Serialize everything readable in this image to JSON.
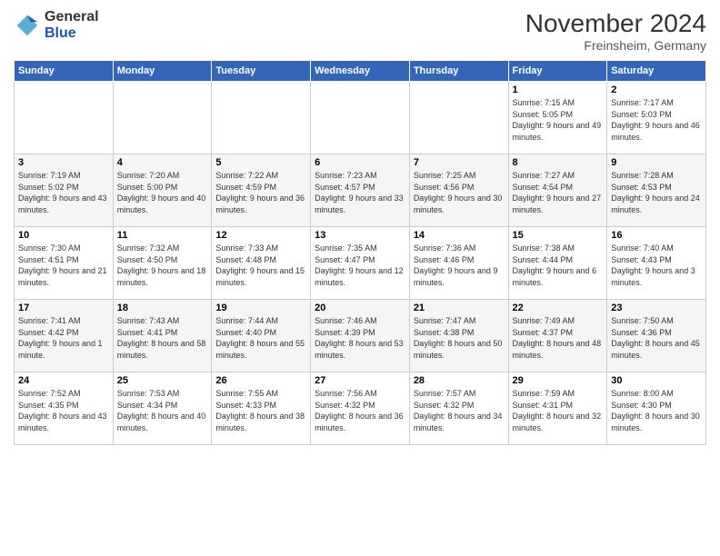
{
  "logo": {
    "general": "General",
    "blue": "Blue"
  },
  "title": "November 2024",
  "subtitle": "Freinsheim, Germany",
  "weekdays": [
    "Sunday",
    "Monday",
    "Tuesday",
    "Wednesday",
    "Thursday",
    "Friday",
    "Saturday"
  ],
  "weeks": [
    [
      {
        "day": "",
        "info": ""
      },
      {
        "day": "",
        "info": ""
      },
      {
        "day": "",
        "info": ""
      },
      {
        "day": "",
        "info": ""
      },
      {
        "day": "",
        "info": ""
      },
      {
        "day": "1",
        "info": "Sunrise: 7:15 AM\nSunset: 5:05 PM\nDaylight: 9 hours and 49 minutes."
      },
      {
        "day": "2",
        "info": "Sunrise: 7:17 AM\nSunset: 5:03 PM\nDaylight: 9 hours and 46 minutes."
      }
    ],
    [
      {
        "day": "3",
        "info": "Sunrise: 7:19 AM\nSunset: 5:02 PM\nDaylight: 9 hours and 43 minutes."
      },
      {
        "day": "4",
        "info": "Sunrise: 7:20 AM\nSunset: 5:00 PM\nDaylight: 9 hours and 40 minutes."
      },
      {
        "day": "5",
        "info": "Sunrise: 7:22 AM\nSunset: 4:59 PM\nDaylight: 9 hours and 36 minutes."
      },
      {
        "day": "6",
        "info": "Sunrise: 7:23 AM\nSunset: 4:57 PM\nDaylight: 9 hours and 33 minutes."
      },
      {
        "day": "7",
        "info": "Sunrise: 7:25 AM\nSunset: 4:56 PM\nDaylight: 9 hours and 30 minutes."
      },
      {
        "day": "8",
        "info": "Sunrise: 7:27 AM\nSunset: 4:54 PM\nDaylight: 9 hours and 27 minutes."
      },
      {
        "day": "9",
        "info": "Sunrise: 7:28 AM\nSunset: 4:53 PM\nDaylight: 9 hours and 24 minutes."
      }
    ],
    [
      {
        "day": "10",
        "info": "Sunrise: 7:30 AM\nSunset: 4:51 PM\nDaylight: 9 hours and 21 minutes."
      },
      {
        "day": "11",
        "info": "Sunrise: 7:32 AM\nSunset: 4:50 PM\nDaylight: 9 hours and 18 minutes."
      },
      {
        "day": "12",
        "info": "Sunrise: 7:33 AM\nSunset: 4:48 PM\nDaylight: 9 hours and 15 minutes."
      },
      {
        "day": "13",
        "info": "Sunrise: 7:35 AM\nSunset: 4:47 PM\nDaylight: 9 hours and 12 minutes."
      },
      {
        "day": "14",
        "info": "Sunrise: 7:36 AM\nSunset: 4:46 PM\nDaylight: 9 hours and 9 minutes."
      },
      {
        "day": "15",
        "info": "Sunrise: 7:38 AM\nSunset: 4:44 PM\nDaylight: 9 hours and 6 minutes."
      },
      {
        "day": "16",
        "info": "Sunrise: 7:40 AM\nSunset: 4:43 PM\nDaylight: 9 hours and 3 minutes."
      }
    ],
    [
      {
        "day": "17",
        "info": "Sunrise: 7:41 AM\nSunset: 4:42 PM\nDaylight: 9 hours and 1 minute."
      },
      {
        "day": "18",
        "info": "Sunrise: 7:43 AM\nSunset: 4:41 PM\nDaylight: 8 hours and 58 minutes."
      },
      {
        "day": "19",
        "info": "Sunrise: 7:44 AM\nSunset: 4:40 PM\nDaylight: 8 hours and 55 minutes."
      },
      {
        "day": "20",
        "info": "Sunrise: 7:46 AM\nSunset: 4:39 PM\nDaylight: 8 hours and 53 minutes."
      },
      {
        "day": "21",
        "info": "Sunrise: 7:47 AM\nSunset: 4:38 PM\nDaylight: 8 hours and 50 minutes."
      },
      {
        "day": "22",
        "info": "Sunrise: 7:49 AM\nSunset: 4:37 PM\nDaylight: 8 hours and 48 minutes."
      },
      {
        "day": "23",
        "info": "Sunrise: 7:50 AM\nSunset: 4:36 PM\nDaylight: 8 hours and 45 minutes."
      }
    ],
    [
      {
        "day": "24",
        "info": "Sunrise: 7:52 AM\nSunset: 4:35 PM\nDaylight: 8 hours and 43 minutes."
      },
      {
        "day": "25",
        "info": "Sunrise: 7:53 AM\nSunset: 4:34 PM\nDaylight: 8 hours and 40 minutes."
      },
      {
        "day": "26",
        "info": "Sunrise: 7:55 AM\nSunset: 4:33 PM\nDaylight: 8 hours and 38 minutes."
      },
      {
        "day": "27",
        "info": "Sunrise: 7:56 AM\nSunset: 4:32 PM\nDaylight: 8 hours and 36 minutes."
      },
      {
        "day": "28",
        "info": "Sunrise: 7:57 AM\nSunset: 4:32 PM\nDaylight: 8 hours and 34 minutes."
      },
      {
        "day": "29",
        "info": "Sunrise: 7:59 AM\nSunset: 4:31 PM\nDaylight: 8 hours and 32 minutes."
      },
      {
        "day": "30",
        "info": "Sunrise: 8:00 AM\nSunset: 4:30 PM\nDaylight: 8 hours and 30 minutes."
      }
    ]
  ]
}
